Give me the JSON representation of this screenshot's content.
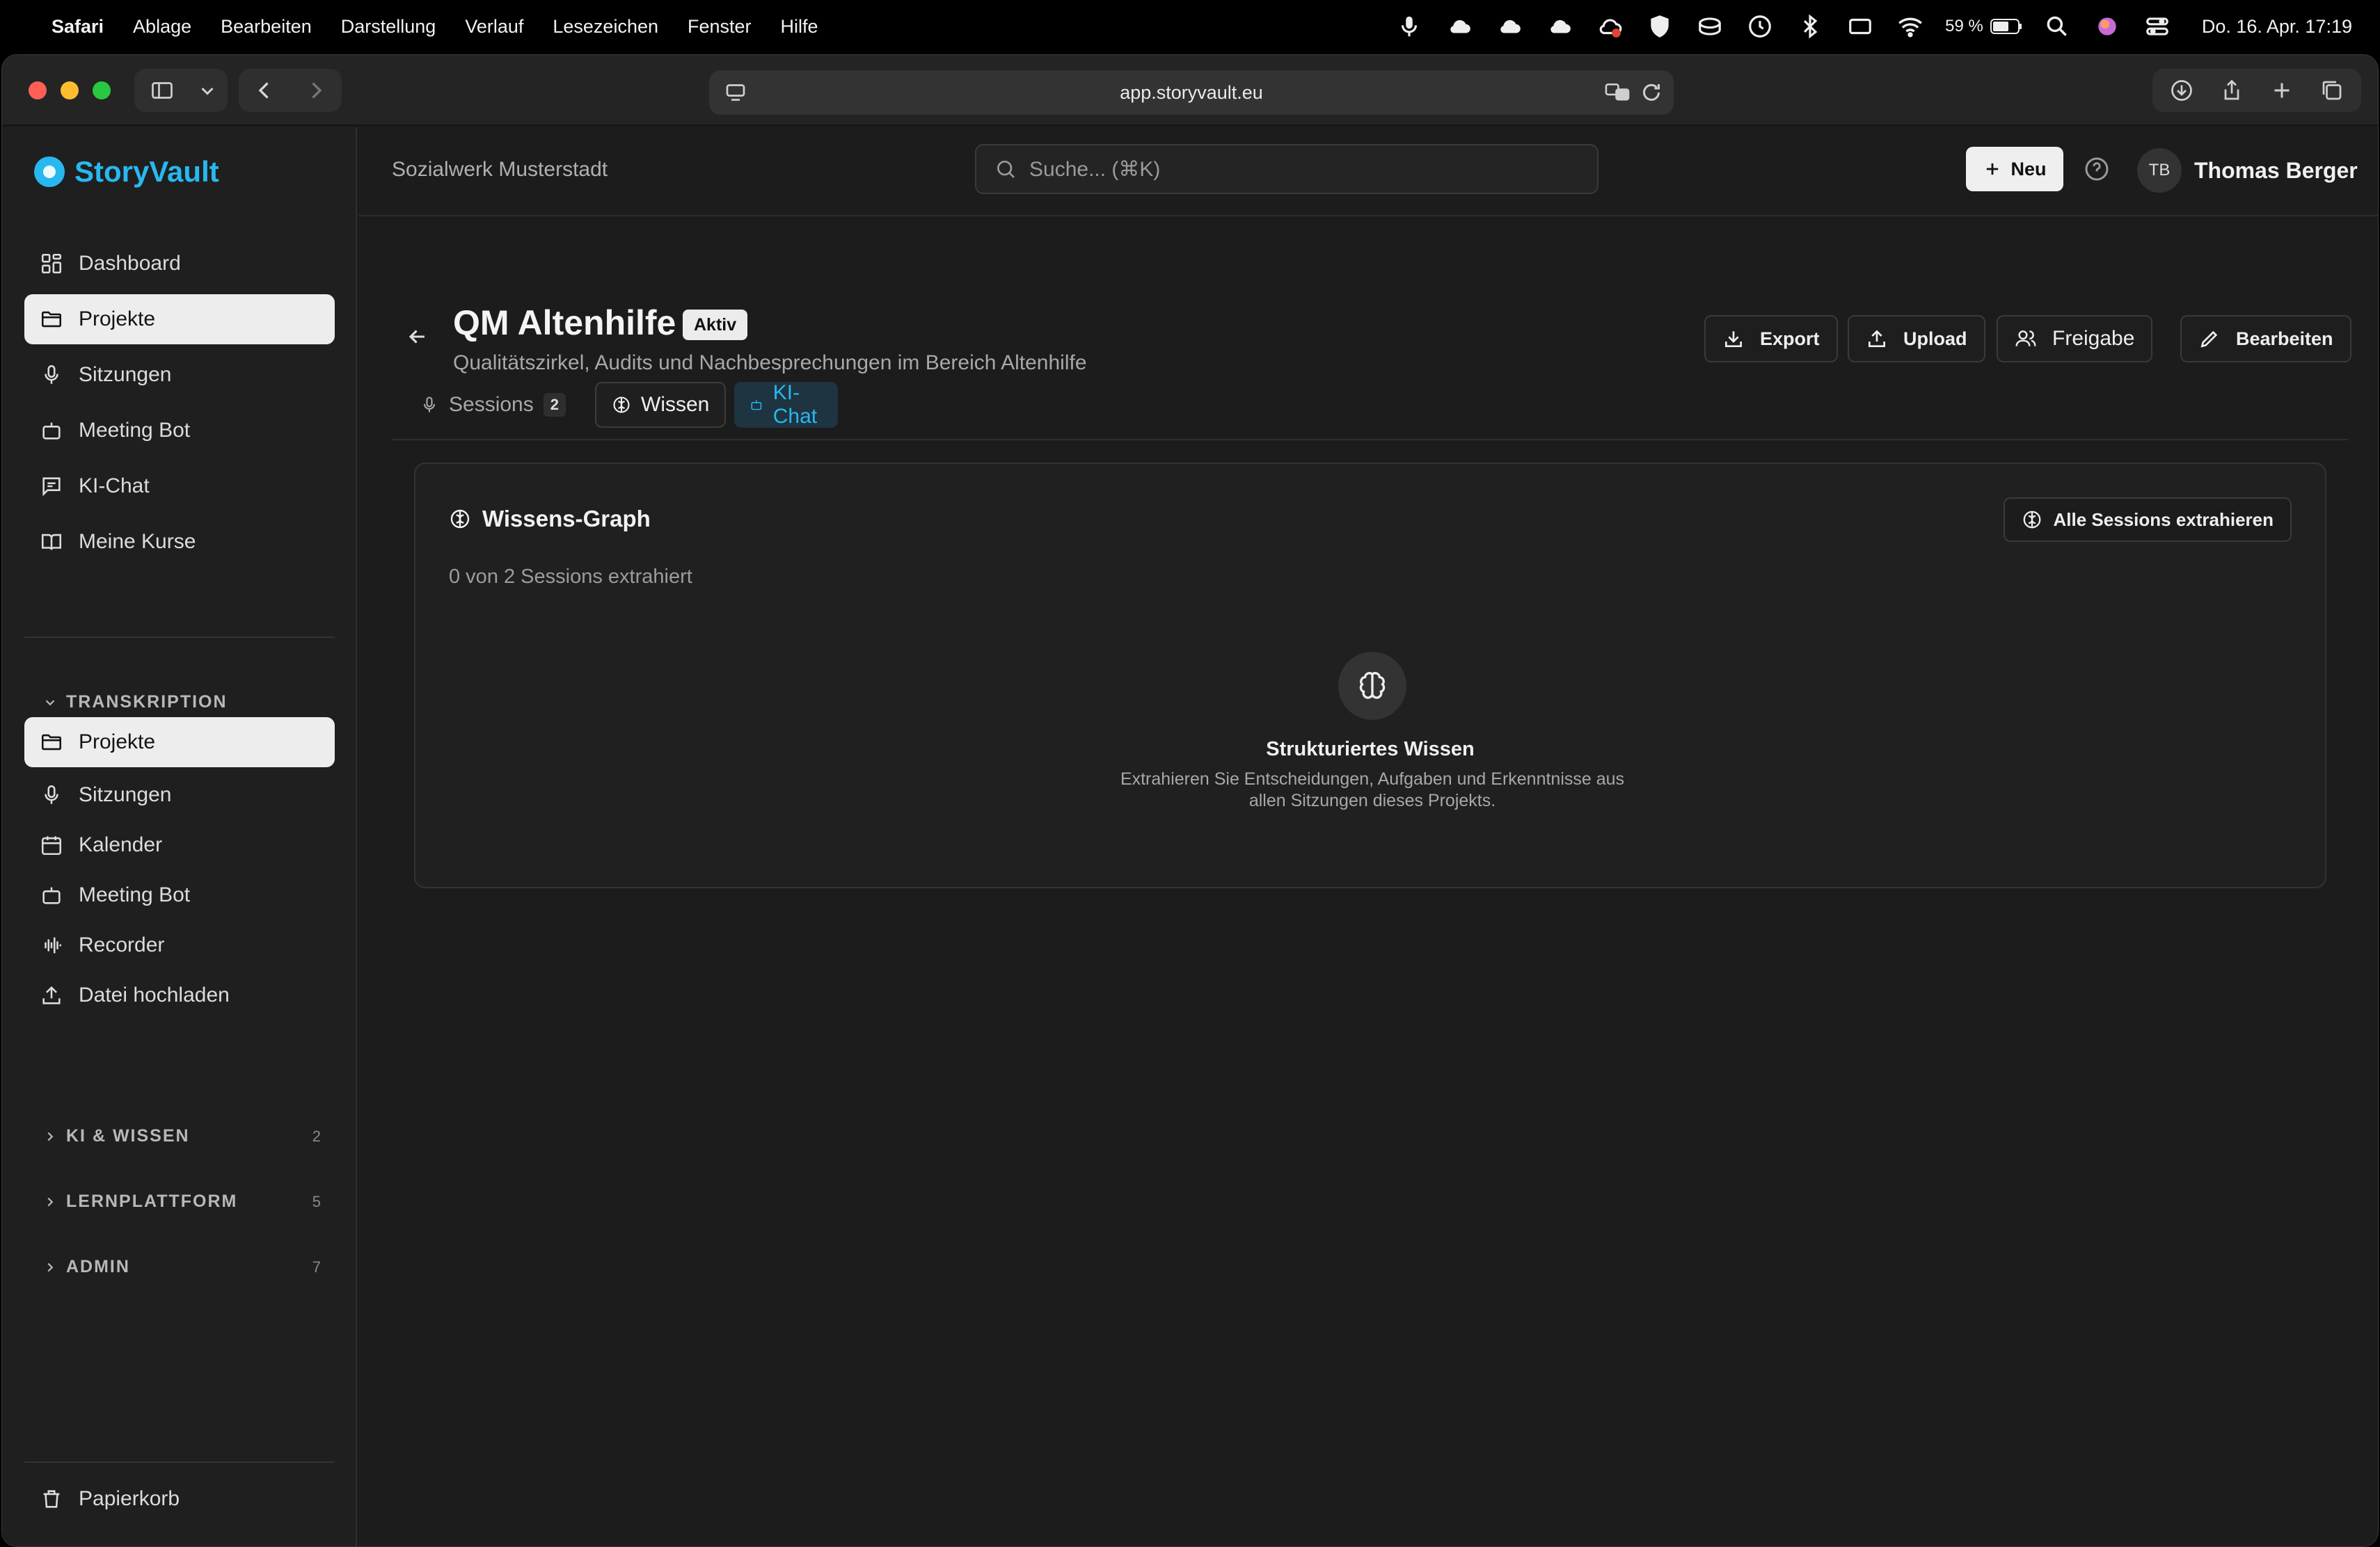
{
  "menubar": {
    "app": "Safari",
    "items": [
      "Ablage",
      "Bearbeiten",
      "Darstellung",
      "Verlauf",
      "Lesezeichen",
      "Fenster",
      "Hilfe"
    ],
    "battery": "59 %",
    "clock": "Do. 16. Apr.  17:19"
  },
  "browser": {
    "url": "app.storyvault.eu"
  },
  "sidebar": {
    "logo": "StoryVault",
    "main": [
      {
        "label": "Dashboard",
        "icon": "dashboard-icon"
      },
      {
        "label": "Projekte",
        "icon": "folder-icon"
      },
      {
        "label": "Sitzungen",
        "icon": "microphone-icon"
      },
      {
        "label": "Meeting Bot",
        "icon": "bot-icon"
      },
      {
        "label": "KI-Chat",
        "icon": "chat-icon"
      },
      {
        "label": "Meine Kurse",
        "icon": "book-icon"
      }
    ],
    "transcription_head": "TRANSKRIPTION",
    "transcription": [
      {
        "label": "Projekte",
        "icon": "folder-icon"
      },
      {
        "label": "Sitzungen",
        "icon": "microphone-icon"
      },
      {
        "label": "Kalender",
        "icon": "calendar-icon"
      },
      {
        "label": "Meeting Bot",
        "icon": "bot-icon"
      },
      {
        "label": "Recorder",
        "icon": "waveform-icon"
      },
      {
        "label": "Datei hochladen",
        "icon": "upload-icon"
      }
    ],
    "sections": [
      {
        "label": "KI & WISSEN",
        "count": "2"
      },
      {
        "label": "LERNPLATTFORM",
        "count": "5"
      },
      {
        "label": "ADMIN",
        "count": "7"
      }
    ],
    "trash": "Papierkorb"
  },
  "header": {
    "org": "Sozialwerk Musterstadt",
    "search_placeholder": "Suche... (⌘K)",
    "new_label": "Neu",
    "avatar_initials": "TB",
    "user_name": "Thomas Berger"
  },
  "project": {
    "title": "QM Altenhilfe",
    "status": "Aktiv",
    "subtitle": "Qualitätszirkel, Audits und Nachbesprechungen im Bereich Altenhilfe",
    "actions": {
      "export": "Export",
      "upload": "Upload",
      "share": "Freigabe",
      "edit": "Bearbeiten"
    },
    "tabs": {
      "sessions": "Sessions",
      "sessions_count": "2",
      "knowledge": "Wissen",
      "chat": "KI-Chat"
    }
  },
  "card": {
    "title": "Wissens-Graph",
    "extract_button": "Alle Sessions extrahieren",
    "status": "0 von 2 Sessions extrahiert",
    "empty_title": "Strukturiertes Wissen",
    "empty_text": "Extrahieren Sie Entscheidungen, Aufgaben und Erkenntnisse aus allen Sitzungen dieses Projekts."
  },
  "colors": {
    "accent": "#28b8f0",
    "background": "#1c1c1c",
    "active_nav": "#ededed"
  }
}
